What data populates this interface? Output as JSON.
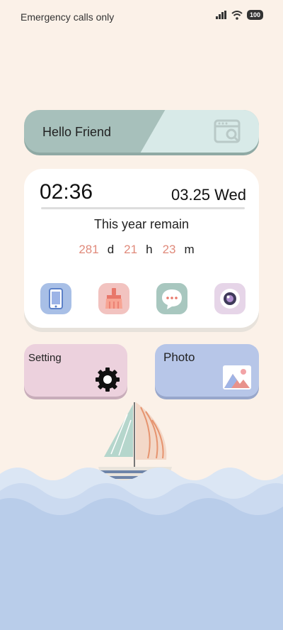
{
  "status_bar": {
    "carrier_text": "Emergency calls only",
    "battery_level": "100",
    "icons": [
      "signal-icon",
      "wifi-icon",
      "battery-icon"
    ]
  },
  "hello_widget": {
    "greeting": "Hello Friend",
    "icon": "browser-search-icon"
  },
  "clock_widget": {
    "time": "02:36",
    "date": "03.25 Wed",
    "remain_label": "This year remain",
    "days": "281",
    "days_unit": "d",
    "hours": "21",
    "hours_unit": "h",
    "minutes": "23",
    "minutes_unit": "m"
  },
  "app_icons": [
    {
      "name": "phone-app-icon",
      "color": "#a8bfe6"
    },
    {
      "name": "cleaner-app-icon",
      "color": "#f2c3c0"
    },
    {
      "name": "messages-app-icon",
      "color": "#a8c7bf"
    },
    {
      "name": "camera-app-icon",
      "color": "#e6d5e8"
    }
  ],
  "tiles": {
    "setting_label": "Setting",
    "photo_label": "Photo"
  },
  "colors": {
    "background": "#fbf1e8",
    "accent_numbers": "#e08a7b",
    "hello_pill": "#a7c0bb",
    "setting_tile": "#ecd1dd",
    "photo_tile": "#b7c6e8",
    "sea": "#b9cdea"
  }
}
